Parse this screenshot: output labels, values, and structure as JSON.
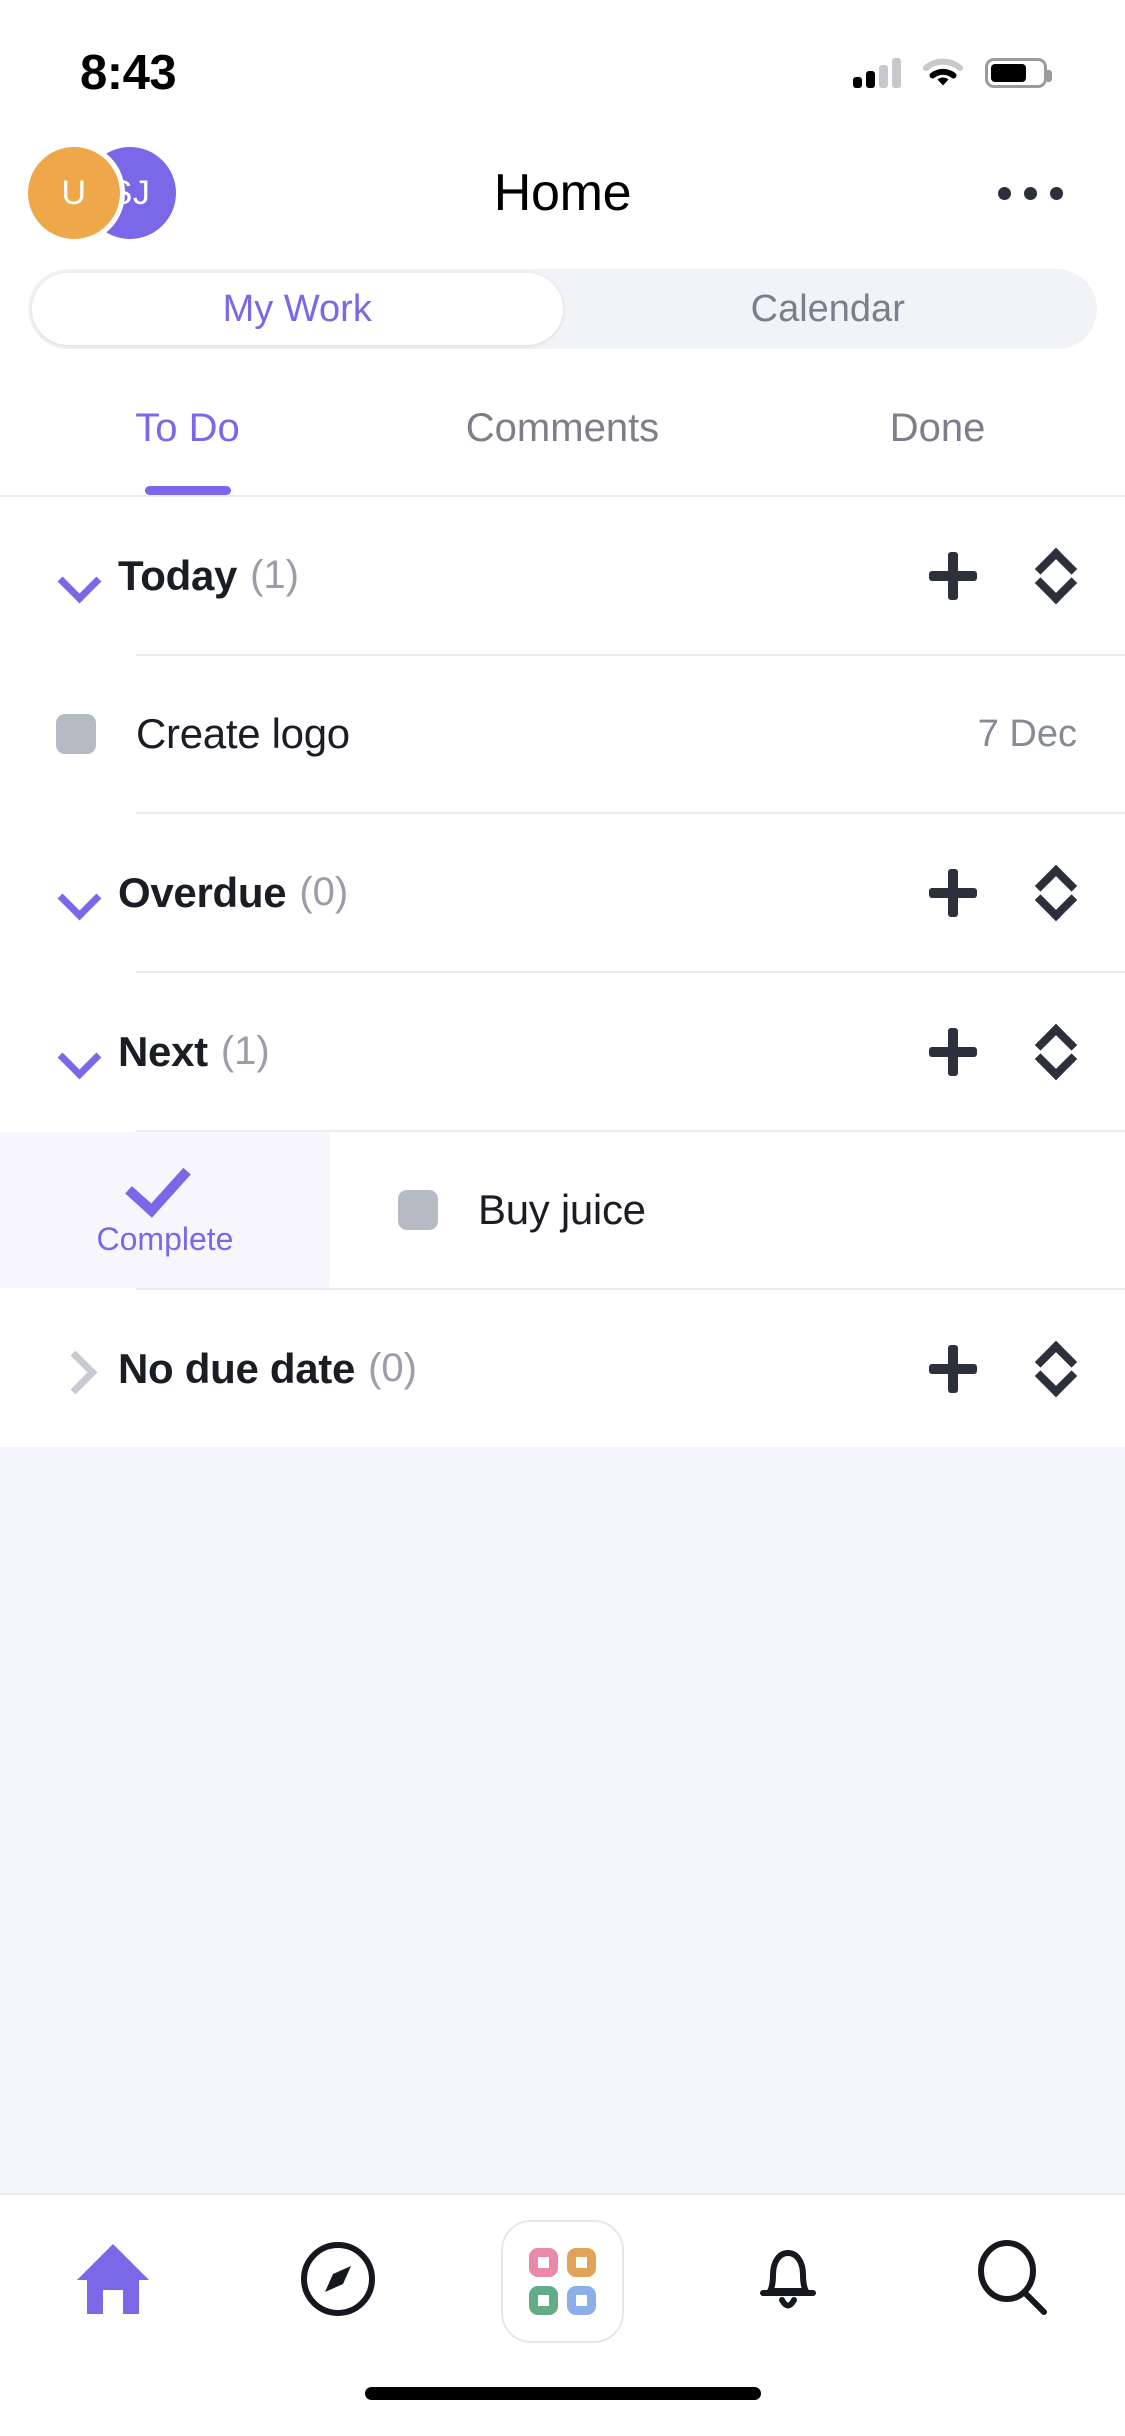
{
  "status_bar": {
    "time": "8:43",
    "signal_icon": "cellular-signal-icon",
    "wifi_icon": "wifi-icon",
    "battery_icon": "battery-icon",
    "battery_level_percent": 62
  },
  "header": {
    "title": "Home",
    "avatars": [
      {
        "initials": "U",
        "color": "#efa849",
        "name": "avatar-user-u"
      },
      {
        "initials": "SJ",
        "color": "#7b68e8",
        "name": "avatar-user-sj"
      }
    ],
    "more_icon": "more-horizontal-icon"
  },
  "segmented_control": {
    "items": [
      {
        "label": "My Work",
        "active": true
      },
      {
        "label": "Calendar",
        "active": false
      }
    ]
  },
  "tabs": [
    {
      "label": "To Do",
      "active": true
    },
    {
      "label": "Comments",
      "active": false
    },
    {
      "label": "Done",
      "active": false
    }
  ],
  "sections": [
    {
      "title": "Today",
      "count": "(1)",
      "expanded": true,
      "chevron_icon": "chevron-down-icon",
      "add_icon": "plus-icon",
      "sort_icon": "sort-updown-icon",
      "tasks": [
        {
          "name": "Create logo",
          "date": "7 Dec",
          "checkbox_icon": "checkbox-unchecked-icon"
        }
      ]
    },
    {
      "title": "Overdue",
      "count": "(0)",
      "expanded": true,
      "chevron_icon": "chevron-down-icon",
      "add_icon": "plus-icon",
      "sort_icon": "sort-updown-icon",
      "tasks": []
    },
    {
      "title": "Next",
      "count": "(1)",
      "expanded": true,
      "chevron_icon": "chevron-down-icon",
      "add_icon": "plus-icon",
      "sort_icon": "sort-updown-icon",
      "tasks": [
        {
          "name": "Buy juice",
          "date": "",
          "checkbox_icon": "checkbox-unchecked-icon"
        }
      ]
    },
    {
      "title": "No due date",
      "count": "(0)",
      "expanded": false,
      "chevron_icon": "chevron-right-icon",
      "add_icon": "plus-icon",
      "sort_icon": "sort-updown-icon",
      "tasks": []
    }
  ],
  "swipe_action": {
    "label": "Complete",
    "icon": "checkmark-icon",
    "color": "#7b68e8",
    "background": "#f6f6fc",
    "applies_to_task": "Buy juice"
  },
  "bottom_nav": [
    {
      "icon": "home-icon",
      "active": true
    },
    {
      "icon": "compass-icon",
      "active": false
    },
    {
      "icon": "apps-grid-icon",
      "active": false
    },
    {
      "icon": "bell-icon",
      "active": false
    },
    {
      "icon": "search-icon",
      "active": false
    }
  ],
  "apps_grid_colors": {
    "top_left": "#e98aa8",
    "top_right": "#e0a357",
    "bottom_left": "#64ab88",
    "bottom_right": "#8cafe8"
  },
  "theme": {
    "accent": "#7b68e8",
    "text_primary": "#1a1d23",
    "text_muted": "#868a95",
    "page_background": "#f4f5f8",
    "divider": "#ececf0"
  },
  "home_indicator": "home-indicator-bar"
}
